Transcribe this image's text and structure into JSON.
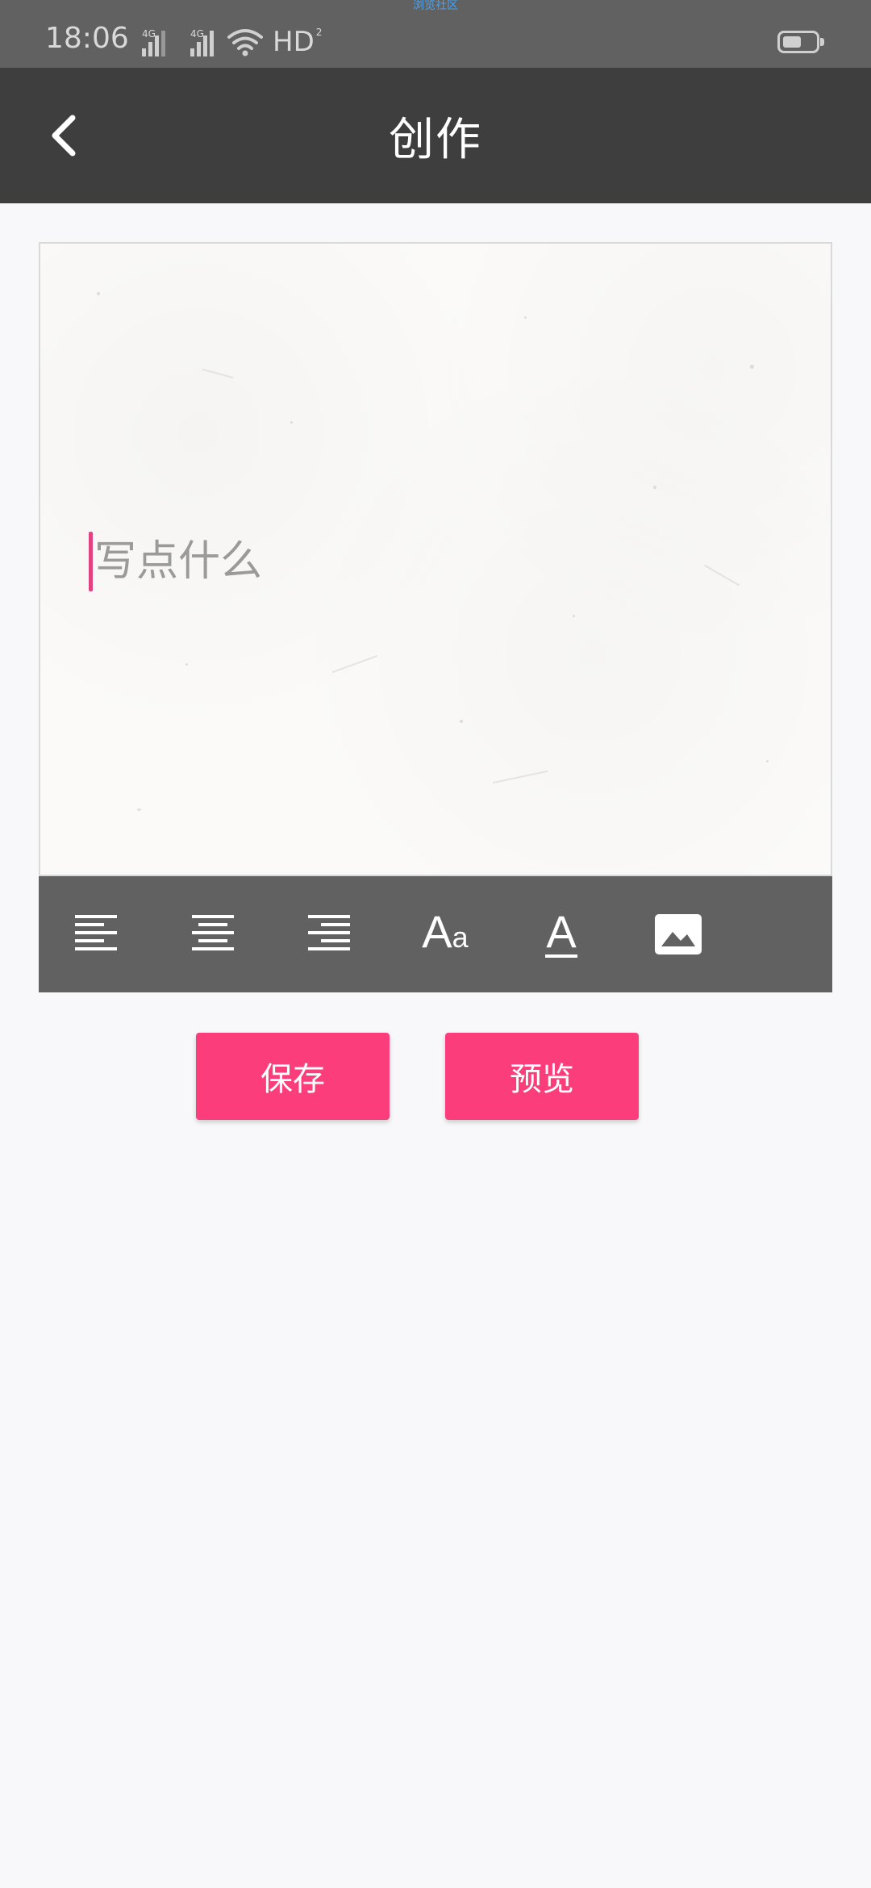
{
  "status_bar": {
    "top_hint": "浏览社区",
    "time": "18:06",
    "signal1_label": "4G",
    "signal2_label": "4G",
    "hd_label": "HD",
    "hd_sub": "2"
  },
  "header": {
    "title": "创作",
    "back_icon": "chevron-left-icon"
  },
  "editor": {
    "placeholder": "写点什么",
    "value": "",
    "cursor_color": "#e24380"
  },
  "toolbar": {
    "items": [
      {
        "name": "align-left-icon"
      },
      {
        "name": "align-center-icon"
      },
      {
        "name": "align-right-icon"
      },
      {
        "name": "font-size-icon",
        "label": "A",
        "sub": "a"
      },
      {
        "name": "font-color-icon",
        "label": "A"
      },
      {
        "name": "image-icon"
      }
    ]
  },
  "actions": {
    "save_label": "保存",
    "preview_label": "预览",
    "accent_color": "#fb3e7b"
  },
  "colors": {
    "status_bar": "#616161",
    "title_bar": "#3e3e3e",
    "toolbar": "#616161",
    "background": "#f8f8fa"
  }
}
